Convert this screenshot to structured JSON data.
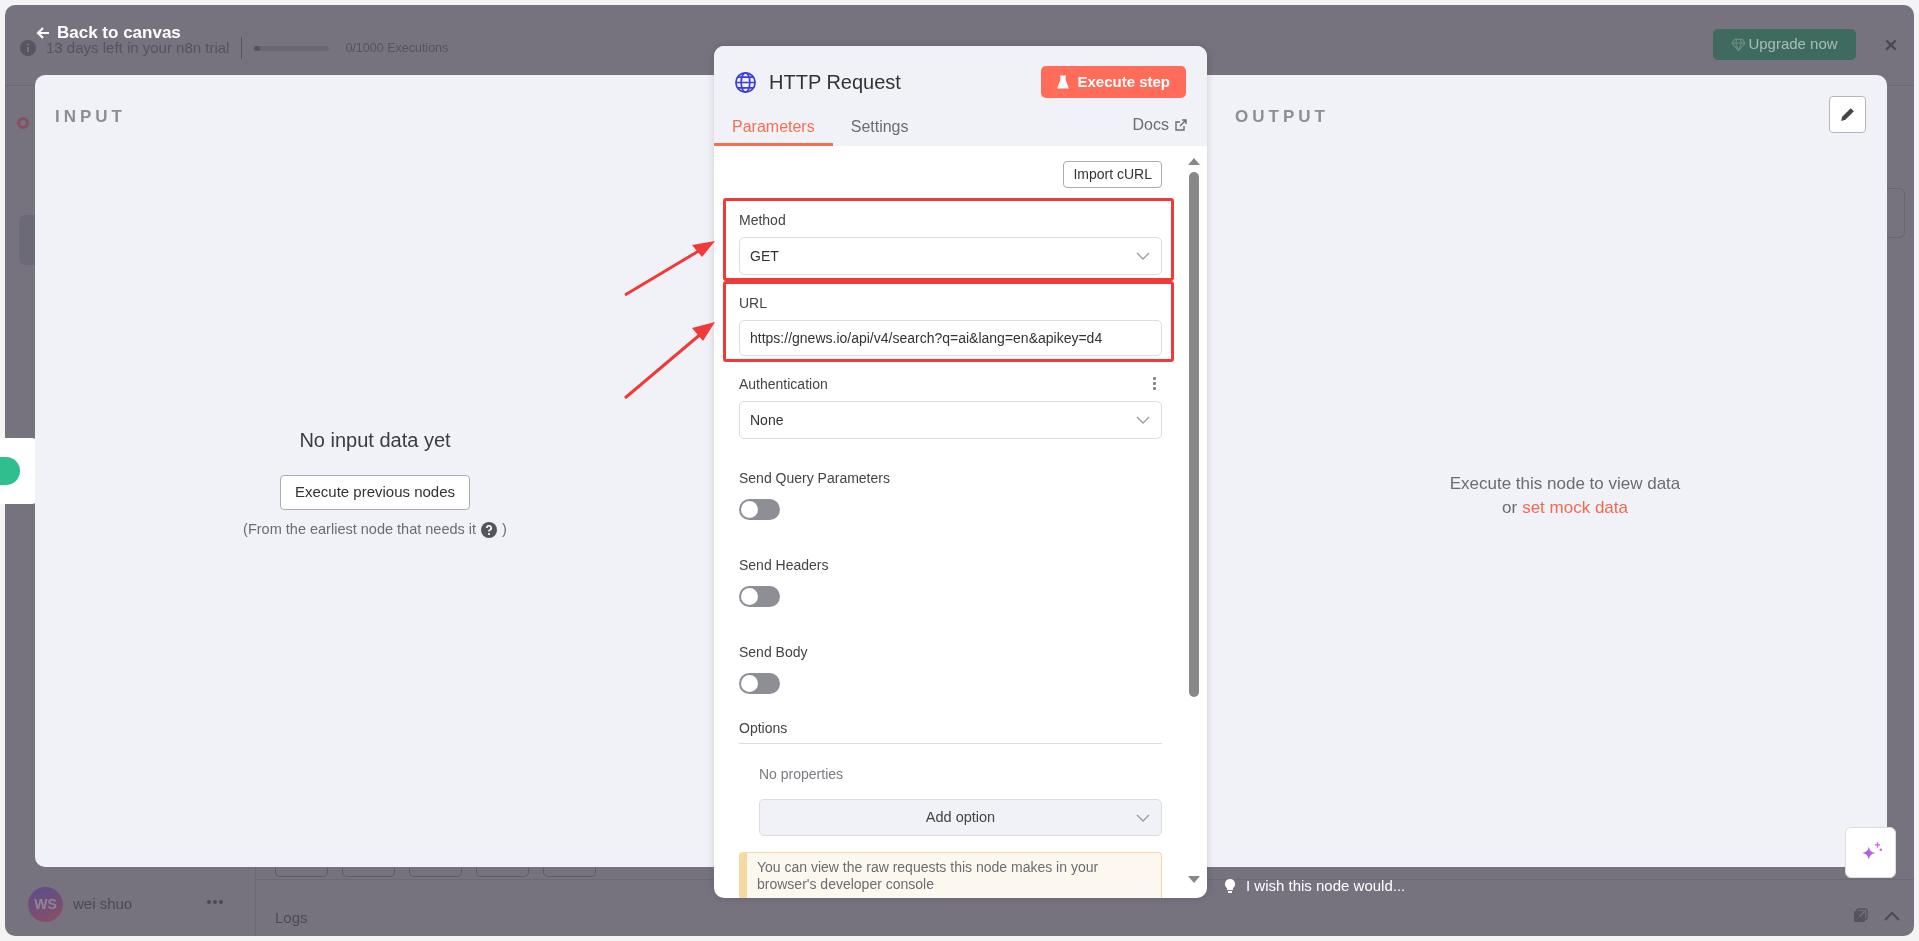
{
  "back_link": "Back to canvas",
  "trial_banner": {
    "text": "13 days left in your n8n trial",
    "usage": "0/1000 Executions",
    "level": 0.02,
    "upgrade_button": "Upgrade now"
  },
  "input_panel": {
    "heading": "INPUT",
    "empty_title": "No input data yet",
    "button": "Execute previous nodes",
    "hint": "(From the earliest node that needs it",
    "hint_end": ")"
  },
  "node_panel": {
    "title": "HTTP Request",
    "execute_button": "Execute step",
    "tabs": [
      {
        "label": "Parameters",
        "selected": true
      },
      {
        "label": "Settings",
        "selected": false
      }
    ],
    "docs_link": "Docs",
    "import_button": "Import cURL",
    "fields": [
      {
        "kind": "select",
        "label": "Method",
        "value": "GET",
        "highlighted": true
      },
      {
        "kind": "input",
        "label": "URL",
        "value": "https://gnews.io/api/v4/search?q=ai&lang=en&apikey=d4",
        "highlighted": true
      },
      {
        "kind": "select",
        "label": "Authentication",
        "value": "None",
        "highlighted": false
      },
      {
        "kind": "toggle",
        "label": "Send Query Parameters",
        "on": false
      },
      {
        "kind": "toggle",
        "label": "Send Headers",
        "on": false
      },
      {
        "kind": "toggle",
        "label": "Send Body",
        "on": false
      }
    ],
    "options": {
      "heading": "Options",
      "empty": "No properties",
      "add_button": "Add option"
    },
    "notice": "You can view the raw requests this node makes in your browser's developer console"
  },
  "output_panel": {
    "heading": "OUTPUT",
    "message": "Execute this node to view data",
    "or_text": "or",
    "mock_link": "set mock data"
  },
  "feedback": "I wish this node would...",
  "user": {
    "initials": "WS",
    "name": "wei shuo"
  },
  "logs_label": "Logs"
}
